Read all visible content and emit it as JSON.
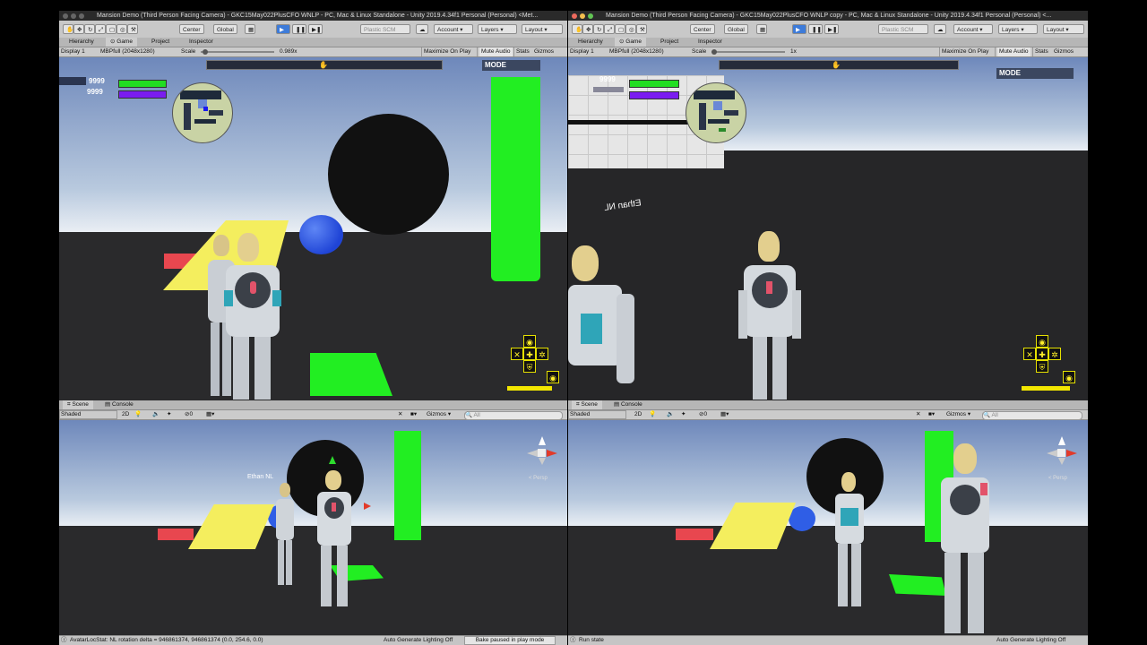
{
  "left": {
    "title": "Mansion Demo (Third Person Facing Camera) - GKC15May022PlusCFO WNLP - PC, Mac & Linux Standalone - Unity 2019.4.34f1 Personal (Personal) <Met...",
    "toolbar": {
      "center": "Center",
      "global": "Global",
      "plastic": "Plastic SCM",
      "account": "Account",
      "layers": "Layers",
      "layout": "Layout"
    },
    "tabs": [
      "Hierarchy",
      "Game",
      "Project",
      "Inspector"
    ],
    "game_bar": {
      "display": "Display 1",
      "resolution": "MBPfull (2048x1280)",
      "scale_label": "Scale",
      "scale_value": "0.989x",
      "maximize": "Maximize On Play",
      "mute": "Mute Audio",
      "stats": "Stats",
      "gizmos": "Gizmos"
    },
    "hud": {
      "health": "9999",
      "energy": "9999",
      "mode": "MODE"
    },
    "scene_tabs": [
      "Scene",
      "Console"
    ],
    "scene_bar": {
      "shaded": "Shaded",
      "twod": "2D",
      "layers_count": "0",
      "gizmos": "Gizmos",
      "search": "All"
    },
    "scene_name_tag": "Ethan NL",
    "persp": "< Persp",
    "status": "AvatarLocStat: NL rotation delta = 946861374, 946861374 (0.0, 254.6, 0.0)",
    "status_right": "Auto Generate Lighting Off",
    "status_paused": "Bake paused in play mode"
  },
  "right": {
    "title": "Mansion Demo (Third Person Facing Camera) - GKC15May022PlusCFO WNLP copy - PC, Mac & Linux Standalone - Unity 2019.4.34f1 Personal (Personal) <...",
    "toolbar": {
      "center": "Center",
      "global": "Global",
      "plastic": "Plastic SCM",
      "account": "Account",
      "layers": "Layers",
      "layout": "Layout"
    },
    "tabs": [
      "Hierarchy",
      "Game",
      "Project",
      "Inspector"
    ],
    "game_bar": {
      "display": "Display 1",
      "resolution": "MBPfull (2048x1280)",
      "scale_label": "Scale",
      "scale_value": "1x",
      "maximize": "Maximize On Play",
      "mute": "Mute Audio",
      "stats": "Stats",
      "gizmos": "Gizmos"
    },
    "hud": {
      "health": "9999",
      "mode": "MODE"
    },
    "name_tag": "Ethan NL",
    "scene_tabs": [
      "Scene",
      "Console"
    ],
    "scene_bar": {
      "shaded": "Shaded",
      "twod": "2D",
      "layers_count": "0",
      "gizmos": "Gizmos",
      "search": "All"
    },
    "persp": "< Persp",
    "status": "Run state",
    "status_right": "Auto Generate Lighting Off"
  },
  "colors": {
    "green": "#22ee22",
    "yellow": "#f4ee5e",
    "blue": "#2b59e6",
    "red": "#e8474f",
    "purple": "#7a1cf0",
    "hud_yellow": "#f2e600"
  }
}
